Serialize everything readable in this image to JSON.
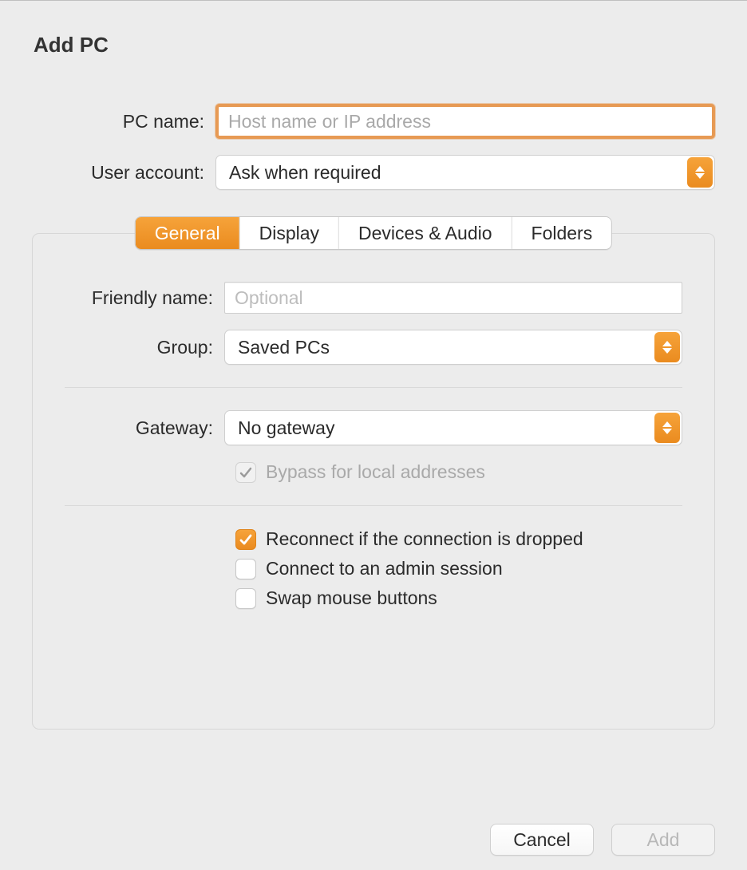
{
  "title": "Add PC",
  "pc_name": {
    "label": "PC name:",
    "placeholder": "Host name or IP address",
    "value": ""
  },
  "user_account": {
    "label": "User account:",
    "value": "Ask when required"
  },
  "tabs": {
    "general": "General",
    "display": "Display",
    "devices_audio": "Devices & Audio",
    "folders": "Folders",
    "active": "general"
  },
  "general": {
    "friendly_name": {
      "label": "Friendly name:",
      "placeholder": "Optional",
      "value": ""
    },
    "group": {
      "label": "Group:",
      "value": "Saved PCs"
    },
    "gateway": {
      "label": "Gateway:",
      "value": "No gateway"
    },
    "bypass_local": {
      "label": "Bypass for local addresses",
      "checked": true,
      "enabled": false
    },
    "reconnect": {
      "label": "Reconnect if the connection is dropped",
      "checked": true
    },
    "admin_session": {
      "label": "Connect to an admin session",
      "checked": false
    },
    "swap_mouse": {
      "label": "Swap mouse buttons",
      "checked": false
    }
  },
  "footer": {
    "cancel": "Cancel",
    "add": "Add",
    "add_enabled": false
  }
}
